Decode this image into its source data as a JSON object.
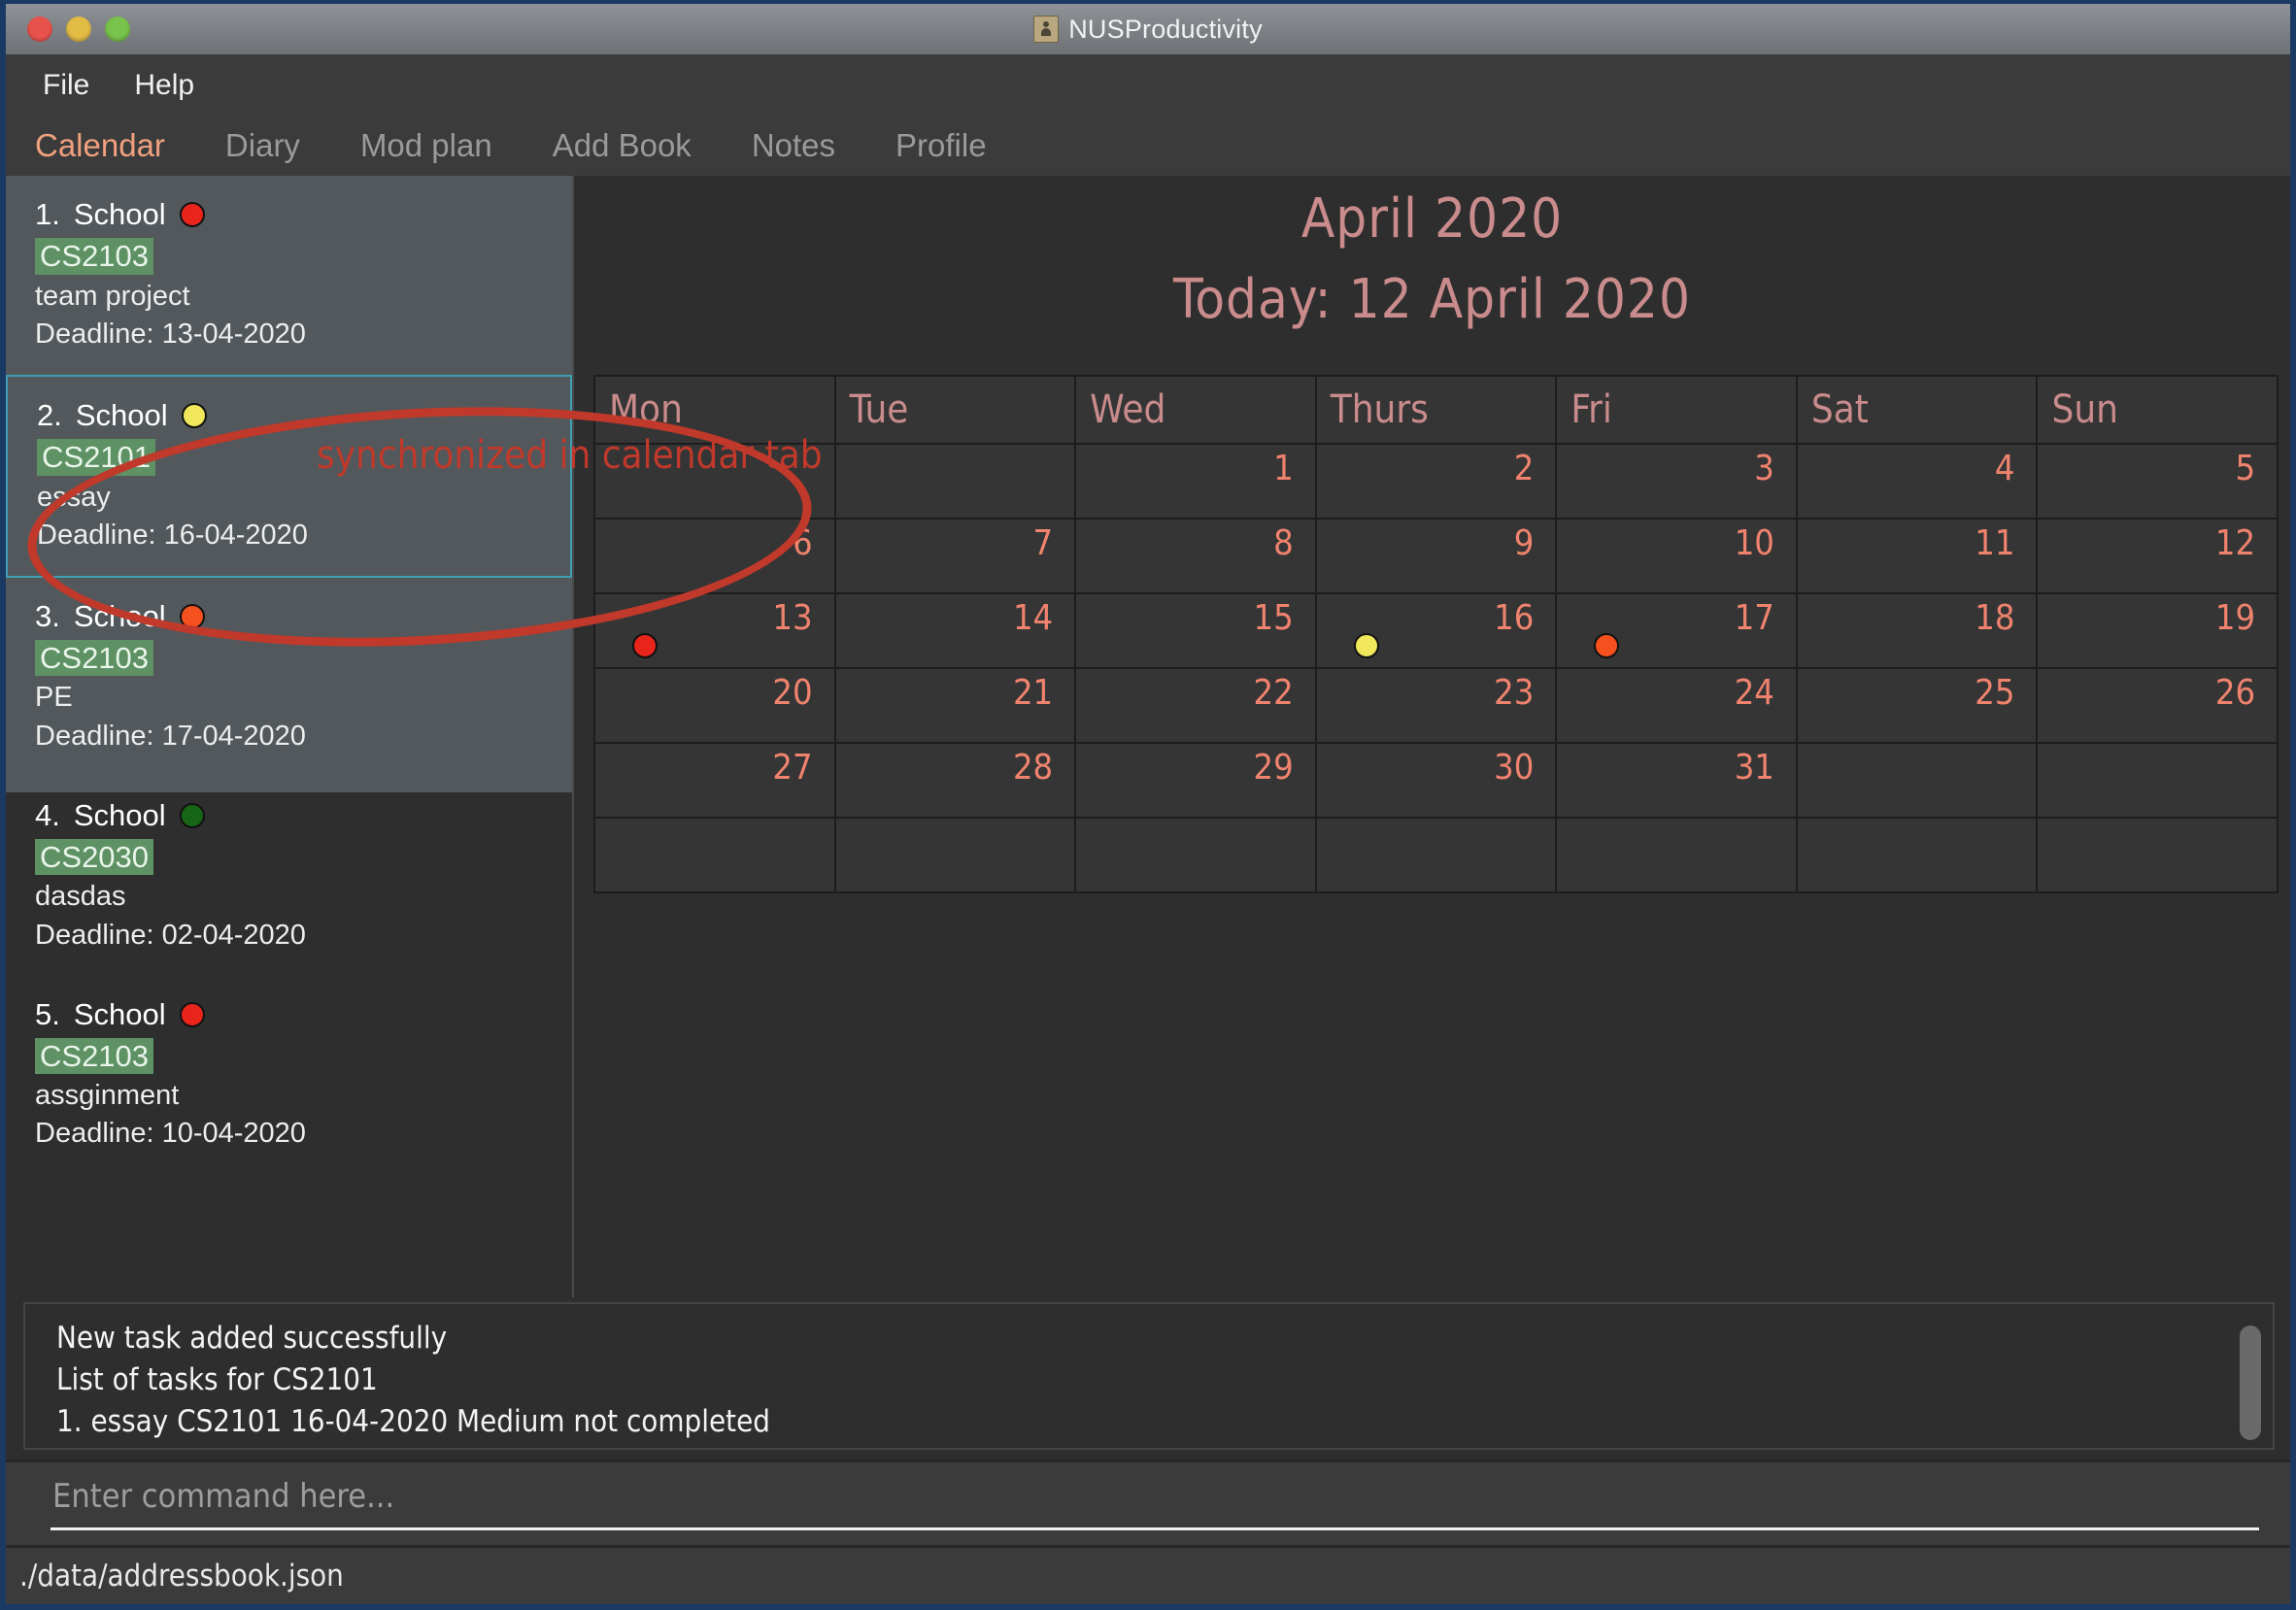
{
  "window": {
    "title": "NUSProductivity",
    "icon": "contact-card-icon",
    "traffic_lights": [
      "close",
      "minimize",
      "zoom"
    ]
  },
  "menubar": {
    "items": [
      {
        "label": "File"
      },
      {
        "label": "Help"
      }
    ]
  },
  "tabs": [
    {
      "label": "Calendar",
      "active": true
    },
    {
      "label": "Diary",
      "active": false
    },
    {
      "label": "Mod plan",
      "active": false
    },
    {
      "label": "Add Book",
      "active": false
    },
    {
      "label": "Notes",
      "active": false
    },
    {
      "label": "Profile",
      "active": false
    }
  ],
  "tasks": [
    {
      "index": "1.",
      "category": "School",
      "priority_color": "#e8241b",
      "module": "CS2103",
      "description": "team project",
      "deadline": "Deadline: 13-04-2020",
      "selected": false
    },
    {
      "index": "2.",
      "category": "School",
      "priority_color": "#f0e85a",
      "module": "CS2101",
      "description": "essay",
      "deadline": "Deadline: 16-04-2020",
      "selected": true
    },
    {
      "index": "3.",
      "category": "School",
      "priority_color": "#f4511e",
      "module": "CS2103",
      "description": "PE",
      "deadline": "Deadline: 17-04-2020",
      "selected": false
    },
    {
      "index": "4.",
      "category": "School",
      "priority_color": "#176617",
      "module": "CS2030",
      "description": "dasdas",
      "deadline": "Deadline: 02-04-2020",
      "selected": false
    },
    {
      "index": "5.",
      "category": "School",
      "priority_color": "#e8241b",
      "module": "CS2103",
      "description": "assginment",
      "deadline": "Deadline: 10-04-2020",
      "selected": false
    }
  ],
  "calendar": {
    "month_title": "April 2020",
    "today_label": "Today: 12 April 2020",
    "daynames": [
      "Mon",
      "Tue",
      "Wed",
      "Thurs",
      "Fri",
      "Sat",
      "Sun"
    ],
    "weeks": [
      [
        {
          "day": ""
        },
        {
          "day": ""
        },
        {
          "day": "1"
        },
        {
          "day": "2"
        },
        {
          "day": "3"
        },
        {
          "day": "4"
        },
        {
          "day": "5"
        }
      ],
      [
        {
          "day": "6"
        },
        {
          "day": "7"
        },
        {
          "day": "8"
        },
        {
          "day": "9"
        },
        {
          "day": "10"
        },
        {
          "day": "11"
        },
        {
          "day": "12"
        }
      ],
      [
        {
          "day": "13",
          "dot": "#e8241b"
        },
        {
          "day": "14"
        },
        {
          "day": "15"
        },
        {
          "day": "16",
          "dot": "#f0e85a"
        },
        {
          "day": "17",
          "dot": "#f4511e"
        },
        {
          "day": "18"
        },
        {
          "day": "19"
        }
      ],
      [
        {
          "day": "20"
        },
        {
          "day": "21"
        },
        {
          "day": "22"
        },
        {
          "day": "23"
        },
        {
          "day": "24"
        },
        {
          "day": "25"
        },
        {
          "day": "26"
        }
      ],
      [
        {
          "day": "27"
        },
        {
          "day": "28"
        },
        {
          "day": "29"
        },
        {
          "day": "30"
        },
        {
          "day": "31"
        },
        {
          "day": ""
        },
        {
          "day": ""
        }
      ],
      [
        {
          "day": ""
        },
        {
          "day": ""
        },
        {
          "day": ""
        },
        {
          "day": ""
        },
        {
          "day": ""
        },
        {
          "day": ""
        },
        {
          "day": ""
        }
      ]
    ]
  },
  "annotation": {
    "text": "synchronized in calendar tab",
    "color": "#c0392b",
    "shape": "ellipse-highlight"
  },
  "result_console": {
    "lines": [
      "New task added successfully",
      "List of tasks for CS2101",
      "1. essay   CS2101  16-04-2020   Medium   not completed"
    ]
  },
  "command_box": {
    "value": "",
    "placeholder": "Enter command here..."
  },
  "statusbar": {
    "path": "./data/addressbook.json"
  }
}
